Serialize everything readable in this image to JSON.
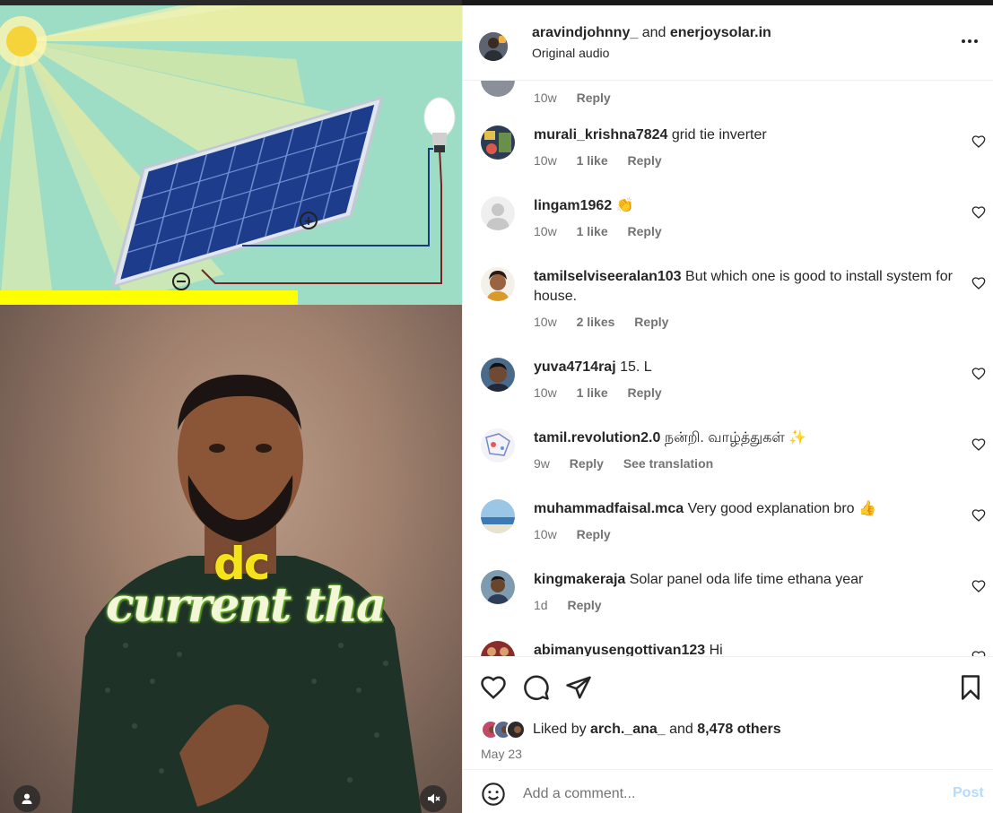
{
  "media": {
    "caption_line1": "dc",
    "caption_line2": "current tha",
    "user_tag_icon": "person-icon",
    "mute_icon": "volume-muted-icon"
  },
  "header": {
    "user1": "aravindjohnny_",
    "and": "and",
    "user2": "enerjoysolar.in",
    "audio": "Original audio",
    "more_icon": "more-horizontal-icon"
  },
  "comments": [
    {
      "user": "",
      "text": "",
      "time": "10w",
      "likes": "",
      "reply": "Reply",
      "extra": ""
    },
    {
      "user": "murali_krishna7824",
      "text": "grid tie inverter",
      "time": "10w",
      "likes": "1 like",
      "reply": "Reply",
      "extra": ""
    },
    {
      "user": "lingam1962",
      "text": "👏",
      "time": "10w",
      "likes": "1 like",
      "reply": "Reply",
      "extra": ""
    },
    {
      "user": "tamilselviseeralan103",
      "text": "But which one is good to install system for house.",
      "time": "10w",
      "likes": "2 likes",
      "reply": "Reply",
      "extra": ""
    },
    {
      "user": "yuva4714raj",
      "text": "15. L",
      "time": "10w",
      "likes": "1 like",
      "reply": "Reply",
      "extra": ""
    },
    {
      "user": "tamil.revolution2.0",
      "text": "நன்றி. வாழ்த்துகள் ✨",
      "time": "9w",
      "likes": "",
      "reply": "Reply",
      "extra": "See translation"
    },
    {
      "user": "muhammadfaisal.mca",
      "text": "Very good explanation bro 👍",
      "time": "10w",
      "likes": "",
      "reply": "Reply",
      "extra": ""
    },
    {
      "user": "kingmakeraja",
      "text": "Solar panel oda life time ethana year",
      "time": "1d",
      "likes": "",
      "reply": "Reply",
      "extra": ""
    },
    {
      "user": "abimanyusengottivan123",
      "text": "Hi",
      "time": "",
      "likes": "",
      "reply": "",
      "extra": ""
    }
  ],
  "actions": {
    "like_icon": "heart-icon",
    "comment_icon": "comment-icon",
    "share_icon": "share-icon",
    "save_icon": "bookmark-icon",
    "liked_by_prefix": "Liked by",
    "liked_by_user": "arch._ana_",
    "liked_by_and": "and",
    "liked_by_others": "8,478 others",
    "date": "May 23"
  },
  "add_comment": {
    "placeholder": "Add a comment...",
    "post_label": "Post",
    "emoji_icon": "emoji-icon"
  },
  "colors": {
    "link_blue_disabled": "#b3dbff",
    "secondary_text": "#737373",
    "diagram_bg": "#9ddcc5",
    "caption_yellow": "#f4e21b",
    "highlight_yellow": "#ffff00"
  }
}
